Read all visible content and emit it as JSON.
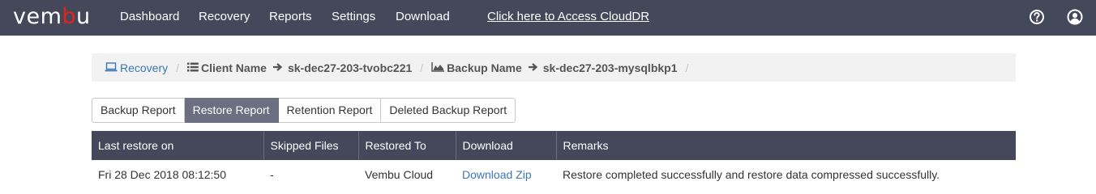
{
  "brand": {
    "part1": "vem",
    "part2": "b",
    "part3": "u"
  },
  "nav": {
    "items": [
      "Dashboard",
      "Recovery",
      "Reports",
      "Settings",
      "Download"
    ],
    "cloud_link": "Click here to Access CloudDR",
    "help_icon": "help-icon",
    "user_icon": "user-icon"
  },
  "breadcrumb": {
    "recovery": "Recovery",
    "client_label": "Client Name",
    "client_value": "sk-dec27-203-tvobc221",
    "backup_label": "Backup Name",
    "backup_value": "sk-dec27-203-mysqlbkp1",
    "separator": "/"
  },
  "tabs": [
    "Backup Report",
    "Restore Report",
    "Retention Report",
    "Deleted Backup Report"
  ],
  "active_tab": "Restore Report",
  "table": {
    "headers": [
      "Last restore on",
      "Skipped Files",
      "Restored To",
      "Download",
      "Remarks"
    ],
    "rows": [
      [
        "Fri 28 Dec 2018 08:12:50",
        "-",
        "Vembu Cloud",
        "Download Zip",
        "Restore completed successfully and restore data compressed successfully."
      ]
    ]
  },
  "colors": {
    "nav_bg": "#45485a",
    "accent_red": "#e2231a",
    "link": "#3b78b8",
    "active_tab": "#6c6f81"
  }
}
